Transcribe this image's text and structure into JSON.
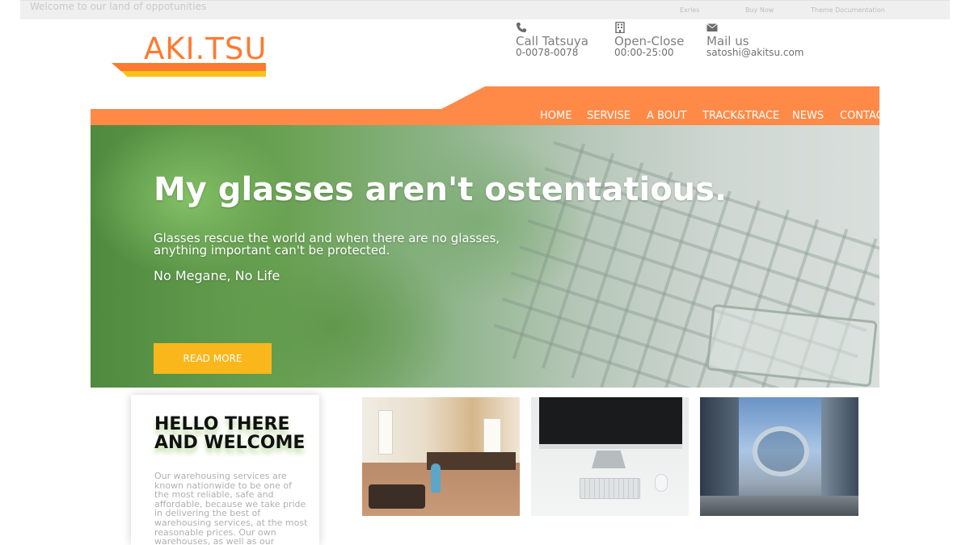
{
  "topbar": {
    "welcome": "Welcome to our land of oppotunities",
    "links": [
      "Exrles",
      "Buy Now",
      "Theme Documentation"
    ]
  },
  "logo": {
    "text": "AKI.TSU"
  },
  "contact": {
    "call": {
      "icon": "phone-icon",
      "title": "Call Tatsuya",
      "value": "0-0078-0078"
    },
    "hours": {
      "icon": "building-icon",
      "title": "Open-Close",
      "value": "00:00-25:00"
    },
    "mail": {
      "icon": "envelope-icon",
      "title": "Mail us",
      "value": "satoshi@akitsu.com"
    }
  },
  "nav": {
    "items": [
      "HOME",
      "SERVISE",
      "A BOUT",
      "TRACK&TRACE",
      "NEWS",
      "CONTACT"
    ]
  },
  "hero": {
    "title": "My glasses aren't ostentatious.",
    "subtitle_line1": "Glasses rescue the world and when there are no glasses,",
    "subtitle_line2": "anything important can't be protected.",
    "tagline": "No Megane, No Life",
    "button": "READ MORE"
  },
  "welcome": {
    "title_line1": "HELLO THERE",
    "title_line2": "AND WELCOME",
    "body": "Our warehousing services are known nationwide to be one of the most reliable, safe and affordable, because we take pride in delivering the best of warehousing services, at the most reasonable prices. Our own warehouses, as well as our"
  },
  "colors": {
    "accent_orange": "#ff8a47",
    "logo_orange": "#ff7a2f",
    "button_yellow": "#f9b71c"
  }
}
